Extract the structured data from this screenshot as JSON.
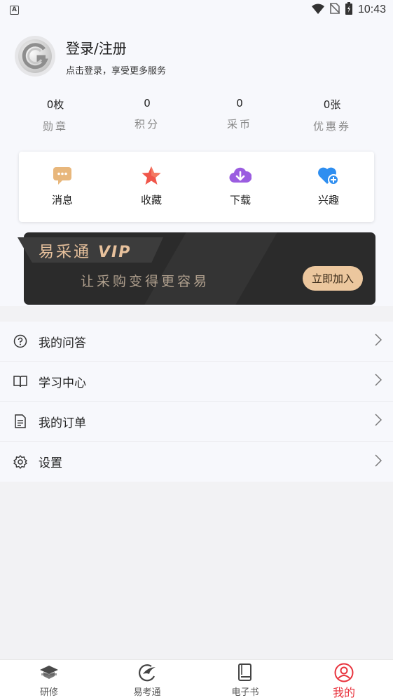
{
  "status_bar": {
    "indicator": "A",
    "time": "10:43"
  },
  "profile": {
    "login_title": "登录/注册",
    "login_subtitle": "点击登录，享受更多服务"
  },
  "stats": [
    {
      "value": "0枚",
      "label": "勋章"
    },
    {
      "value": "0",
      "label": "积分"
    },
    {
      "value": "0",
      "label": "采币"
    },
    {
      "value": "0张",
      "label": "优惠券"
    }
  ],
  "quick_actions": [
    {
      "label": "消息",
      "icon": "message-icon"
    },
    {
      "label": "收藏",
      "icon": "star-icon"
    },
    {
      "label": "下载",
      "icon": "download-cloud-icon"
    },
    {
      "label": "兴趣",
      "icon": "heart-plus-icon"
    }
  ],
  "vip": {
    "title": "易采通",
    "tag": "VIP",
    "slogan": "让采购变得更容易",
    "join_label": "立即加入"
  },
  "menu": [
    {
      "label": "我的问答",
      "icon": "question-icon"
    },
    {
      "label": "学习中心",
      "icon": "book-icon"
    },
    {
      "label": "我的订单",
      "icon": "document-icon"
    },
    {
      "label": "设置",
      "icon": "gear-icon"
    }
  ],
  "bottom_nav": [
    {
      "label": "研修",
      "icon": "graduation-cap-icon"
    },
    {
      "label": "易考通",
      "icon": "bird-logo-icon"
    },
    {
      "label": "电子书",
      "icon": "ebook-icon"
    },
    {
      "label": "我的",
      "icon": "user-circle-icon",
      "active": true
    }
  ],
  "colors": {
    "accent": "#e8333d",
    "vip_gold": "#e7c19c",
    "vip_button": "#ecc79e"
  }
}
